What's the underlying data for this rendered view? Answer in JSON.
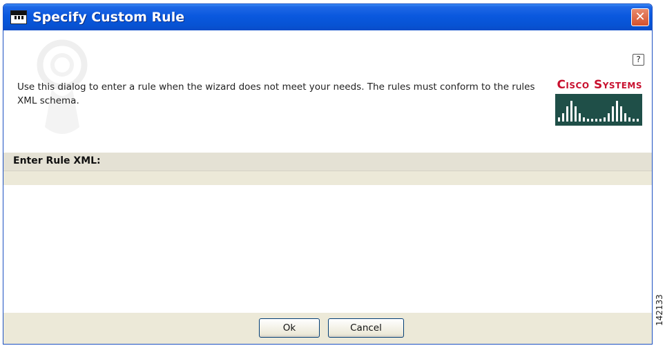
{
  "window": {
    "title": "Specify Custom Rule",
    "close_glyph": "✕"
  },
  "header": {
    "help_glyph": "?",
    "description": "Use this dialog to enter a rule when the wizard does not meet your needs. The rules must conform to the rules XML schema.",
    "brand_name": "Cisco Systems"
  },
  "section": {
    "label": "Enter Rule XML:"
  },
  "editor": {
    "value": ""
  },
  "buttons": {
    "ok_label": "Ok",
    "cancel_label": "Cancel"
  },
  "figure_number": "142133",
  "colors": {
    "titlebar": "#0a58de",
    "brand_red": "#c8102e",
    "brand_bars_bg": "#1f4f48",
    "dialog_bg": "#ece9d8"
  },
  "icons": {
    "app": "app-window-icon",
    "help": "help-icon",
    "close": "close-icon",
    "watermark": "globe-watermark-icon",
    "logo": "cisco-bars-logo-icon"
  }
}
